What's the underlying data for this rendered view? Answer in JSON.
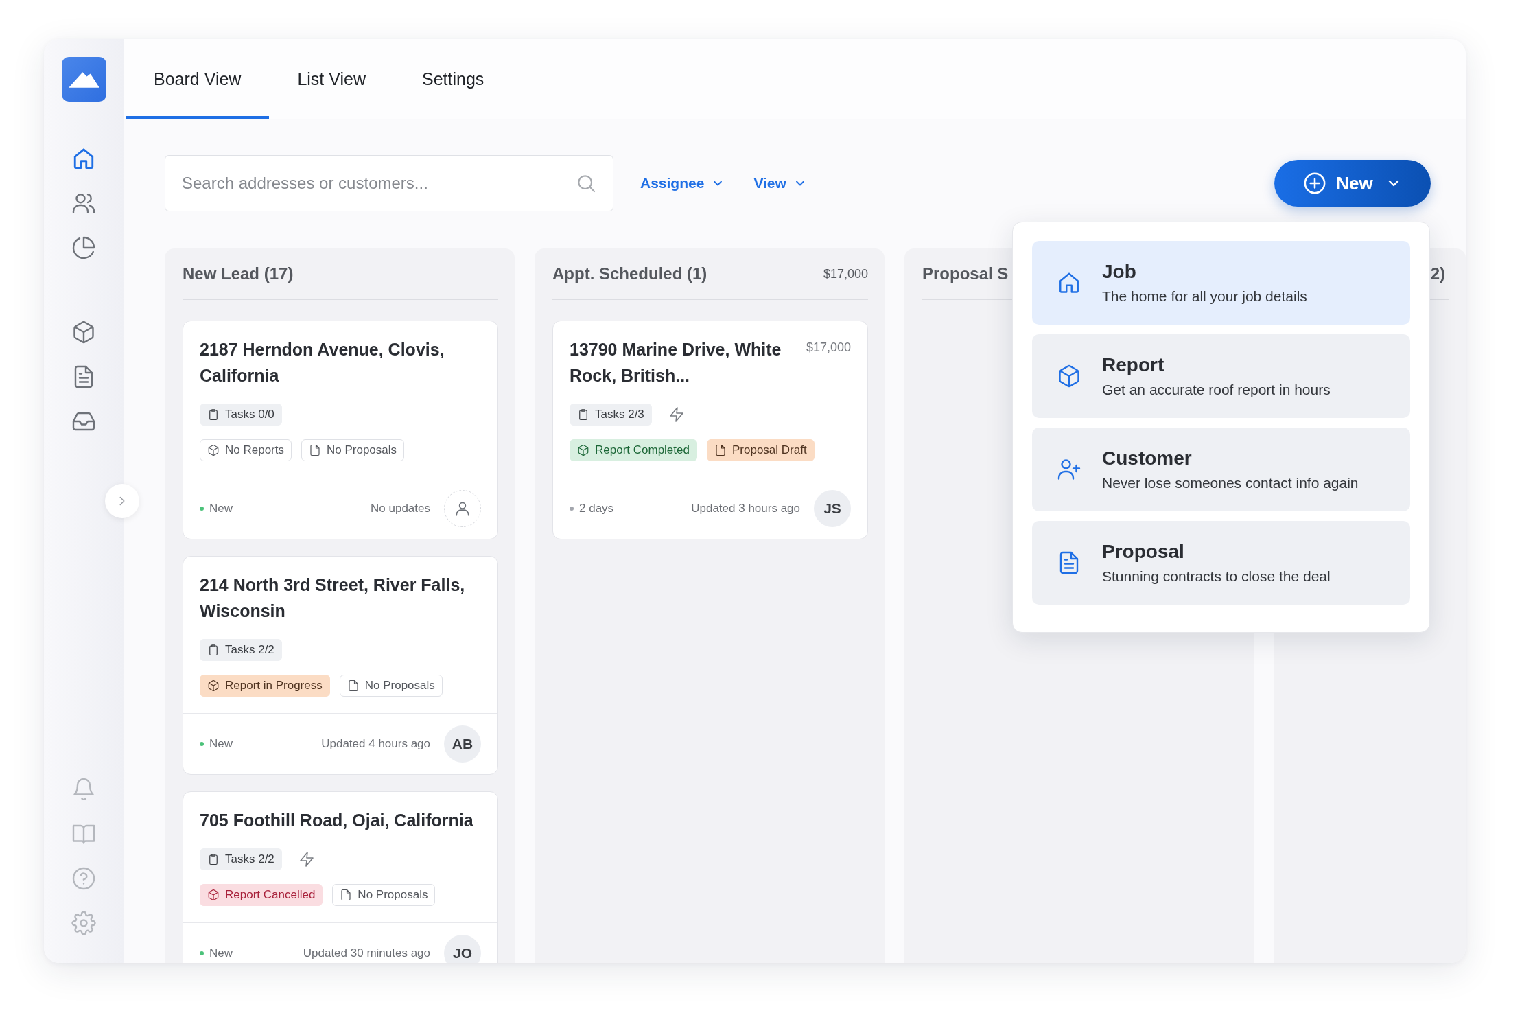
{
  "tabs": [
    {
      "label": "Board View",
      "selected": true
    },
    {
      "label": "List View",
      "selected": false
    },
    {
      "label": "Settings",
      "selected": false
    }
  ],
  "sidebar": {
    "top_items": [
      {
        "kind": "home",
        "selected": true
      },
      {
        "kind": "people",
        "selected": false
      },
      {
        "kind": "chart",
        "selected": false
      }
    ],
    "middle_items": [
      {
        "kind": "cube",
        "selected": false
      },
      {
        "kind": "document",
        "selected": false
      },
      {
        "kind": "inbox",
        "selected": false
      }
    ],
    "bottom_items": [
      {
        "kind": "bell",
        "selected": false
      },
      {
        "kind": "book",
        "selected": false
      },
      {
        "kind": "help",
        "selected": false
      },
      {
        "kind": "settings",
        "selected": false
      }
    ]
  },
  "toolbar": {
    "search": {
      "placeholder": "Search addresses or customers..."
    },
    "filters": [
      {
        "label": "Assignee"
      },
      {
        "label": "View"
      }
    ],
    "new_button": {
      "label": "New",
      "expanded": true
    }
  },
  "new_menu": [
    {
      "kind": "job",
      "title": "Job",
      "description": "The home for all your job details",
      "selected": true
    },
    {
      "kind": "report",
      "title": "Report",
      "description": "Get an accurate roof report in hours",
      "selected": false
    },
    {
      "kind": "customer",
      "title": "Customer",
      "description": "Never lose someones contact info again",
      "selected": false
    },
    {
      "kind": "proposal",
      "title": "Proposal",
      "description": "Stunning contracts to close the deal",
      "selected": false
    }
  ],
  "columns": [
    {
      "kind": "full",
      "title": "New Lead (17)",
      "cards": [
        {
          "title": "2187 Herndon Avenue, Clovis, California",
          "automation": false,
          "chips": [
            [
              {
                "kind": "tasks",
                "color": "#eef0f3",
                "label": "Tasks 0/0"
              }
            ],
            [
              {
                "kind": "report",
                "color": "#ffffff",
                "label": "No Reports"
              },
              {
                "kind": "proposal",
                "color": "#ffffff",
                "label": "No Proposals"
              }
            ]
          ],
          "status": {
            "label": "New",
            "color": "#4cc27a"
          },
          "updated": "No updates",
          "assignee": {
            "kind": "unassigned"
          }
        },
        {
          "title": "214 North 3rd Street, River Falls, Wisconsin",
          "automation": false,
          "chips": [
            [
              {
                "kind": "tasks",
                "color": "#eef0f3",
                "label": "Tasks 2/2"
              }
            ],
            [
              {
                "kind": "report",
                "color": "#fbdcc4",
                "label": "Report in Progress"
              },
              {
                "kind": "proposal",
                "color": "#ffffff",
                "label": "No Proposals"
              }
            ]
          ],
          "status": {
            "label": "New",
            "color": "#4cc27a"
          },
          "updated": "Updated 4 hours ago",
          "assignee": {
            "kind": "initials",
            "text": "AB"
          }
        },
        {
          "title": "705 Foothill Road, Ojai, California",
          "automation": true,
          "chips": [
            [
              {
                "kind": "tasks",
                "color": "#eef0f3",
                "label": "Tasks 2/2"
              }
            ],
            [
              {
                "kind": "report",
                "color": "#fadde1",
                "label": "Report Cancelled"
              },
              {
                "kind": "proposal",
                "color": "#ffffff",
                "label": "No Proposals"
              }
            ]
          ],
          "status": {
            "label": "New",
            "color": "#4cc27a"
          },
          "updated": "Updated 30 minutes ago",
          "assignee": {
            "kind": "initials",
            "text": "JO"
          }
        }
      ]
    },
    {
      "kind": "full",
      "title": "Appt. Scheduled (1)",
      "amount": "$17,000",
      "cards": [
        {
          "title": "13790 Marine Drive, White Rock, British...",
          "amount": "$17,000",
          "automation": true,
          "chips": [
            [
              {
                "kind": "tasks",
                "color": "#eef0f3",
                "label": "Tasks 2/3"
              }
            ],
            [
              {
                "kind": "report",
                "color": "#d8efe0",
                "label": "Report Completed"
              },
              {
                "kind": "proposal",
                "color": "#fbdcc4",
                "label": "Proposal Draft"
              }
            ]
          ],
          "status": {
            "label": "2 days",
            "color": "#a3a6ad"
          },
          "updated": "Updated 3 hours ago",
          "assignee": {
            "kind": "initials",
            "text": "JS"
          }
        }
      ]
    },
    {
      "kind": "full",
      "title": "Proposal S"
    },
    {
      "kind": "clipped",
      "title": "2)"
    }
  ]
}
